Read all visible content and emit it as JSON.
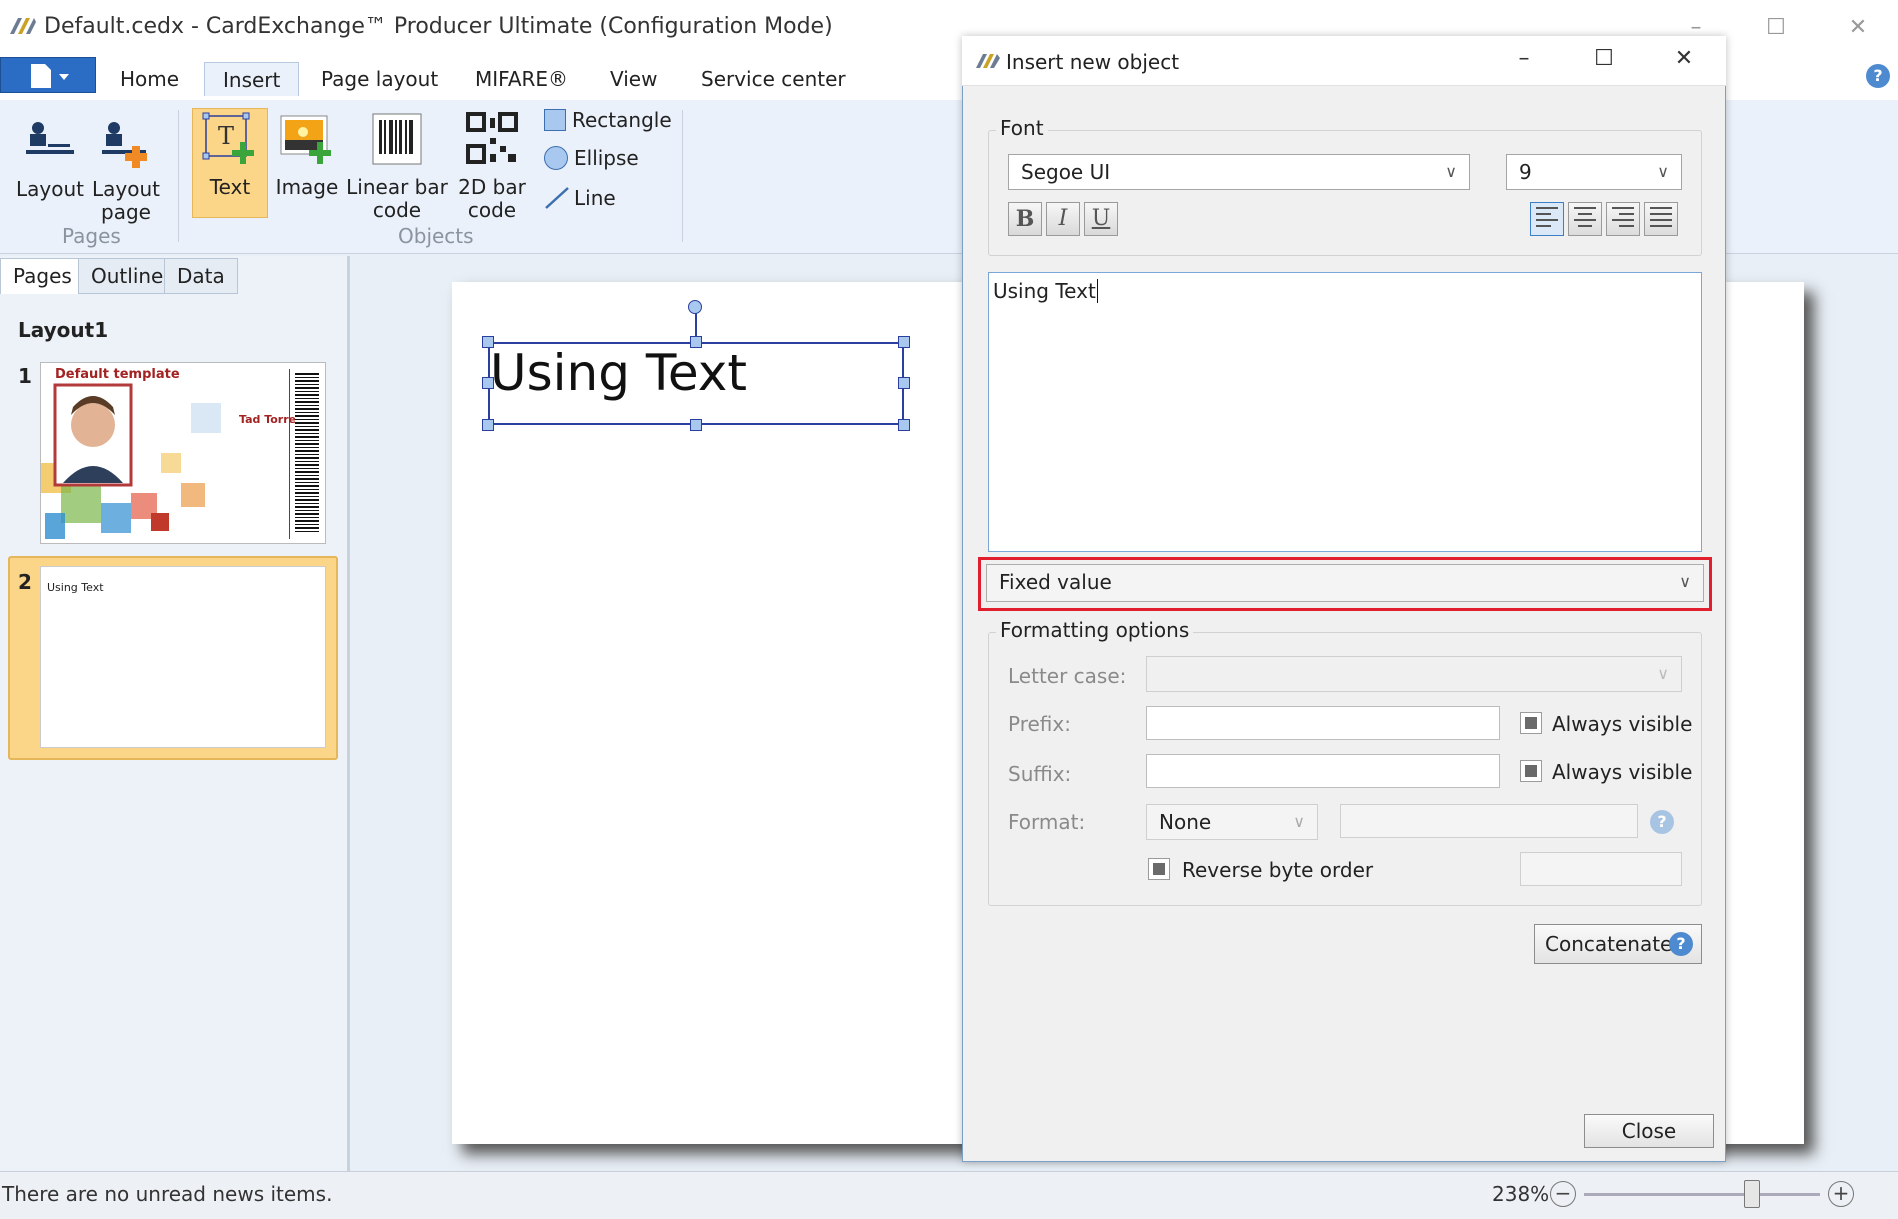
{
  "app": {
    "title": "Default.cedx - CardExchange™ Producer Ultimate (Configuration Mode)"
  },
  "ribbon": {
    "tabs": [
      "Home",
      "Insert",
      "Page layout",
      "MIFARE®",
      "View",
      "Service center"
    ],
    "active_tab": "Insert",
    "pages_group": {
      "label": "Pages",
      "layout": "Layout",
      "layout_page_1": "Layout",
      "layout_page_2": "page"
    },
    "objects_group": {
      "label": "Objects",
      "text": "Text",
      "image": "Image",
      "linear_1": "Linear bar",
      "linear_2": "code",
      "twod_1": "2D bar",
      "twod_2": "code",
      "rectangle": "Rectangle",
      "ellipse": "Ellipse",
      "line": "Line"
    }
  },
  "left_pane": {
    "tabs": [
      "Pages",
      "Outline",
      "Data"
    ],
    "layout_name": "Layout1",
    "page1": {
      "number": "1",
      "template_title": "Default template",
      "person_name": "Tad Torres"
    },
    "page2": {
      "number": "2",
      "text": "Using Text"
    }
  },
  "canvas": {
    "text": "Using Text"
  },
  "status": {
    "news": "There are no unread news items.",
    "zoom": "238%",
    "zoom_level": 0.71
  },
  "dialog": {
    "title": "Insert new object",
    "font_legend": "Font",
    "font_family": "Segoe UI",
    "font_size": "9",
    "bold": "B",
    "italic": "I",
    "underline": "U",
    "text_value": "Using Text",
    "source": "Fixed value",
    "formatting_legend": "Formatting options",
    "letter_case_label": "Letter case:",
    "prefix_label": "Prefix:",
    "suffix_label": "Suffix:",
    "format_label": "Format:",
    "format_value": "None",
    "always_visible": "Always visible",
    "reverse_byte_order": "Reverse byte order",
    "concatenate": "Concatenate",
    "close": "Close"
  },
  "colors": {
    "active_tab": "#fbd689",
    "highlight_box": "#e01e2d",
    "ribbon_bg": "#eaf1fa",
    "selection": "#2b3f9e"
  }
}
